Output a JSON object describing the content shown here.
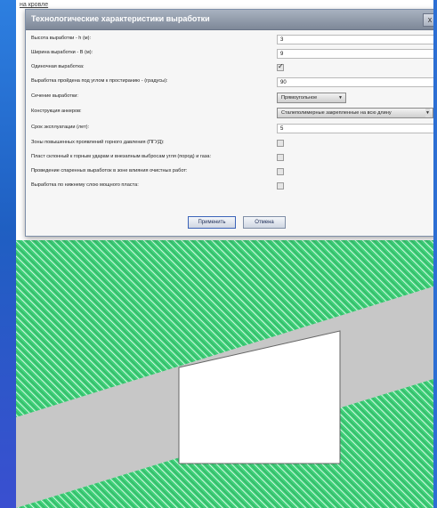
{
  "top_label": "на кровле",
  "dialog": {
    "title": "Технологические характеристики выработки",
    "close_glyph": "x",
    "rows": [
      {
        "label": "Высота выработки - h (м):",
        "value": "3"
      },
      {
        "label": "Ширина выработки - B (м):",
        "value": "9"
      },
      {
        "label": "Одиночная выработка:",
        "checked": true
      },
      {
        "label": "Выработка пройдена под углом к простиранию - (градусы):",
        "value": "90"
      },
      {
        "label": "Сечение выработки:",
        "selected": "Прямоугольное"
      },
      {
        "label": "Конструкция анкеров:",
        "selected": "Сталеполимерные закрепленные на всю длину"
      },
      {
        "label": "Срок эксплуатации (лет):",
        "value": "5"
      },
      {
        "label": "Зоны повышенных проявлений горного давления (ПГУД):",
        "checked": false
      },
      {
        "label": "Пласт склонный к горным ударам и внезапным выбросам угля (пород) и газа:",
        "checked": false
      },
      {
        "label": "Проведение спаренных выработок в зоне влияния очистных работ:",
        "checked": false
      },
      {
        "label": "Выработка по нижнему слою мощного пласта:",
        "checked": false
      }
    ],
    "apply_label": "Применить",
    "cancel_label": "Отмена"
  },
  "colors": {
    "rock_hatch": "#3fd27a",
    "seam_gray": "#c7c7c7",
    "excavation": "#ffffff",
    "dialog_accent": "#3b63b8"
  },
  "icons": {
    "close": "close-icon",
    "dropdown": "chevron-down-icon"
  }
}
